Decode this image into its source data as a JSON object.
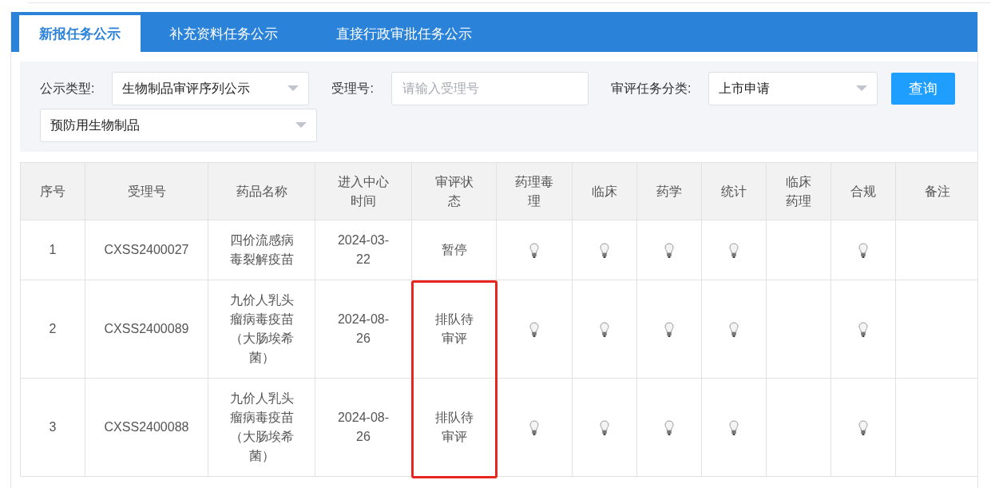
{
  "tabs": [
    {
      "label": "新报任务公示",
      "selected": true
    },
    {
      "label": "补充资料任务公示",
      "selected": false
    },
    {
      "label": "直接行政审批任务公示",
      "selected": false
    }
  ],
  "filters": [
    {
      "kind": "select",
      "label": "公示类型:",
      "value": "生物制品审评序列公示"
    },
    {
      "kind": "input",
      "label": "受理号:",
      "placeholder": "请输入受理号"
    },
    {
      "kind": "select",
      "label": "审评任务分类:",
      "value": "上市申请"
    },
    {
      "kind": "button",
      "text": "查询"
    },
    {
      "kind": "select",
      "value": "预防用生物制品"
    }
  ],
  "table": {
    "columns": [
      "序号",
      "受理号",
      "药品名称",
      "进入中心时间",
      "审评状态",
      "药理毒理",
      "临床",
      "药学",
      "统计",
      "临床药理",
      "合规",
      "备注"
    ],
    "rows": [
      {
        "cells": [
          "1",
          "CXSS2400027",
          "四价流感病毒裂解疫苗",
          "2024-03-22",
          "暂停"
        ],
        "lamps": [
          true,
          true,
          true,
          true,
          false,
          true
        ],
        "highlighted": false
      },
      {
        "cells": [
          "2",
          "CXSS2400089",
          "九价人乳头瘤病毒疫苗（大肠埃希菌）",
          "2024-08-26",
          "排队待审评"
        ],
        "lamps": [
          true,
          true,
          true,
          true,
          false,
          true
        ],
        "highlighted": true
      },
      {
        "cells": [
          "3",
          "CXSS2400088",
          "九价人乳头瘤病毒疫苗（大肠埃希菌）",
          "2024-08-26",
          "排队待审评"
        ],
        "lamps": [
          true,
          true,
          true,
          true,
          false,
          true
        ],
        "highlighted": true
      }
    ]
  },
  "highlight": {
    "color": "#e8251f"
  }
}
